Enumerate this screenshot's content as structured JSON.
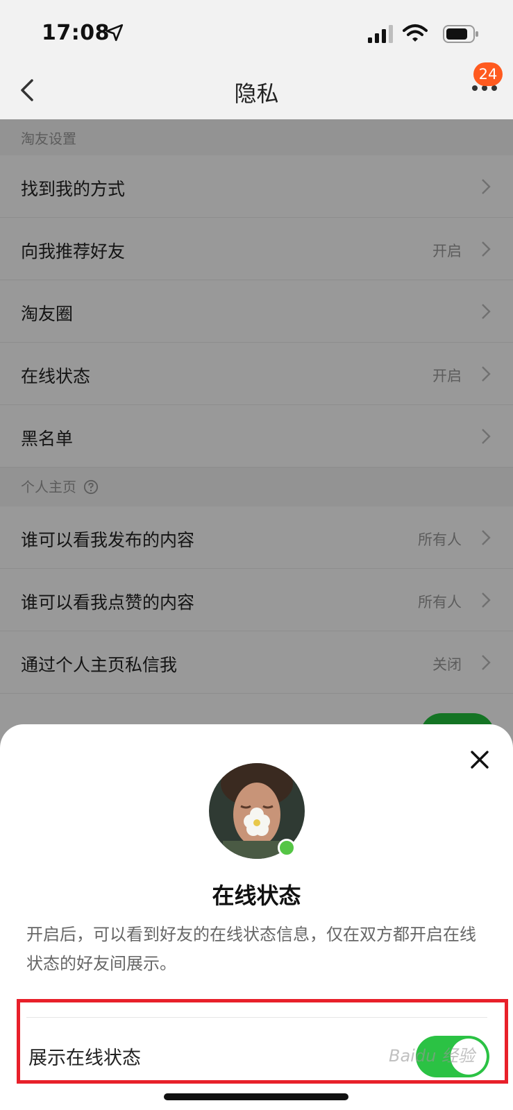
{
  "status_bar": {
    "time": "17:08"
  },
  "nav": {
    "title": "隐私",
    "badge_count": "24"
  },
  "sections": [
    {
      "title": "淘友设置",
      "rows": [
        {
          "label": "找到我的方式",
          "value": ""
        },
        {
          "label": "向我推荐好友",
          "value": "开启"
        },
        {
          "label": "淘友圈",
          "value": ""
        },
        {
          "label": "在线状态",
          "value": "开启"
        },
        {
          "label": "黑名单",
          "value": ""
        }
      ]
    },
    {
      "title": "个人主页",
      "rows": [
        {
          "label": "谁可以看我发布的内容",
          "value": "所有人"
        },
        {
          "label": "谁可以看我点赞的内容",
          "value": "所有人"
        },
        {
          "label": "通过个人主页私信我",
          "value": "关闭"
        }
      ]
    }
  ],
  "sheet": {
    "title": "在线状态",
    "description": "开启后，可以看到好友的在线状态信息，仅在双方都开启在线状态的好友间展示。",
    "toggle_label": "展示在线状态",
    "toggle_on": true
  },
  "watermark": "Baidu 经验",
  "colors": {
    "accent_green": "#2bc244",
    "badge_orange": "#ff5a1f",
    "highlight_red": "#e8202a"
  }
}
